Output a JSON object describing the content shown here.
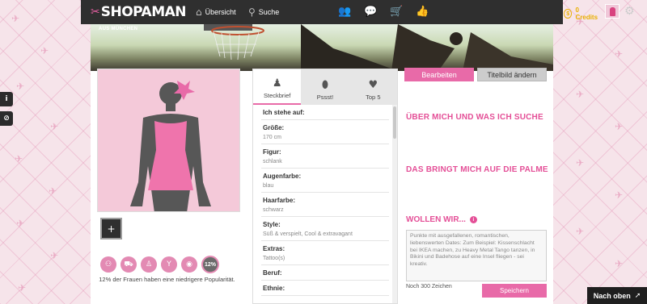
{
  "brand": {
    "logo_text": "SHOPAMAN"
  },
  "nav": [
    {
      "label": "Übersicht",
      "icon": "home-icon"
    },
    {
      "label": "Suche",
      "icon": "search-icon"
    }
  ],
  "top_icons": [
    "users-icon",
    "chat-icon",
    "cart-icon",
    "thumbs-up-icon"
  ],
  "credits": {
    "label": "0 Credits"
  },
  "cover": {
    "location": "AUS MÜNCHEN"
  },
  "buttons": {
    "edit": "Bearbeiten",
    "change_cover": "Titelbild ändern"
  },
  "tabs": [
    {
      "label": "Steckbrief",
      "icon": "user-icon"
    },
    {
      "label": "Pssst!",
      "icon": "lemon-icon"
    },
    {
      "label": "Top 5",
      "icon": "heart-icon"
    }
  ],
  "profile": {
    "fields": [
      {
        "label": "Ich stehe auf:",
        "value": ""
      },
      {
        "label": "Größe:",
        "value": "170 cm"
      },
      {
        "label": "Figur:",
        "value": "schlank"
      },
      {
        "label": "Augenfarbe:",
        "value": "blau"
      },
      {
        "label": "Haarfarbe:",
        "value": "schwarz"
      },
      {
        "label": "Style:",
        "value": "Süß & verspielt, Cool & extravagant"
      },
      {
        "label": "Extras:",
        "value": "Tattoo(s)"
      },
      {
        "label": "Beruf:",
        "value": ""
      },
      {
        "label": "Ethnie:",
        "value": ""
      }
    ]
  },
  "popularity": {
    "percent": "12%",
    "text": "12% der Frauen haben eine niedrigere Popularität.",
    "icons": [
      "people-icon",
      "cart-icon",
      "person-icon",
      "cocktail-icon",
      "chat-icon"
    ]
  },
  "sections": {
    "about": "ÜBER MICH UND WAS ICH SUCHE",
    "annoy": "DAS BRINGT MICH AUF DIE PALME",
    "want": "WOLLEN WIR..."
  },
  "wollen": {
    "text": "Punkte mit ausgefallenen, romantischen, liebenswerten Dates: Zum Beispiel: Kissenschlacht bei IKEA machen, zu Heavy Metal Tango tanzen, in Bikini und Badehose auf eine Insel fliegen - sei kreativ.",
    "char_count": "Noch 300 Zeichen",
    "save": "Speichern"
  },
  "side_tabs": [
    "i",
    "⊘"
  ],
  "scroll_top": "Nach oben",
  "colors": {
    "accent": "#e86aa8",
    "heading": "#e44f97",
    "bar": "#2f2f2f"
  }
}
